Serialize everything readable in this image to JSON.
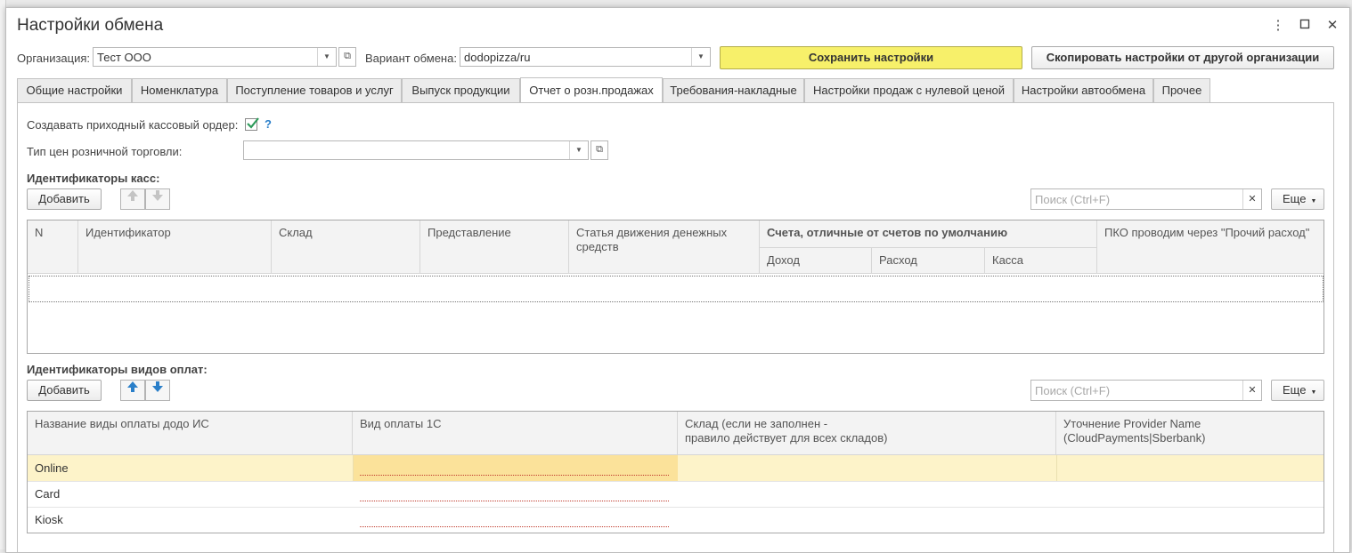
{
  "window": {
    "title": "Настройки обмена",
    "controls": {
      "menu": "⋮",
      "maximize": "□",
      "close": "✕"
    }
  },
  "header": {
    "org_label": "Организация:",
    "org_value": "Тест ООО",
    "variant_label": "Вариант обмена:",
    "variant_value": "dodopizza/ru",
    "save_button": "Сохранить настройки",
    "copy_button": "Скопировать настройки от другой организации"
  },
  "tabs": [
    {
      "label": "Общие настройки"
    },
    {
      "label": "Номенклатура"
    },
    {
      "label": "Поступление товаров и услуг"
    },
    {
      "label": "Выпуск продукции"
    },
    {
      "label": "Отчет о розн.продажах",
      "active": true
    },
    {
      "label": "Требования-накладные"
    },
    {
      "label": "Настройки продаж с нулевой ценой"
    },
    {
      "label": "Настройки автообмена"
    },
    {
      "label": "Прочее"
    }
  ],
  "form": {
    "create_order_label": "Создавать приходный кассовый ордер:",
    "create_order_checked": true,
    "help": "?",
    "price_type_label": "Тип цен розничной торговли:",
    "price_type_value": ""
  },
  "cash_section": {
    "title": "Идентификаторы касс:",
    "add_button": "Добавить",
    "search_placeholder": "Поиск (Ctrl+F)",
    "more_button": "Еще",
    "columns": {
      "n": "N",
      "identifier": "Идентификатор",
      "warehouse": "Склад",
      "representation": "Представление",
      "cash_flow": "Статья движения денежных средств",
      "accounts_group": "Счета, отличные от счетов по умолчанию",
      "income": "Доход",
      "expense": "Расход",
      "cash": "Касса",
      "pko": "ПКО проводим через  \"Прочий расход\""
    }
  },
  "payment_section": {
    "title": "Идентификаторы видов оплат:",
    "add_button": "Добавить",
    "search_placeholder": "Поиск (Ctrl+F)",
    "more_button": "Еще",
    "columns": {
      "name": "Название виды оплаты додо ИС",
      "type_1c": "Вид оплаты 1С",
      "warehouse_line1": "Склад (если не заполнен -",
      "warehouse_line2": "правило действует для всех складов)",
      "provider_line1": "Уточнение Provider Name",
      "provider_line2": "(CloudPayments|Sberbank)"
    },
    "rows": [
      {
        "name": "Online",
        "selected": true
      },
      {
        "name": "Card"
      },
      {
        "name": "Kiosk"
      }
    ]
  },
  "colors": {
    "accent_yellow": "#f7f06a",
    "selected_row": "#fdf3c9",
    "check_green": "#2e9b5b",
    "arrow_blue": "#2a7fc9"
  }
}
